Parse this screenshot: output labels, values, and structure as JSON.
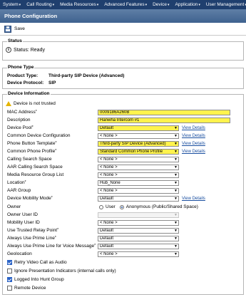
{
  "menubar": {
    "items": [
      "System",
      "Call Routing",
      "Media Resources",
      "Advanced Features",
      "Device",
      "Application",
      "User Management"
    ]
  },
  "page_title": "Phone Configuration",
  "toolbar": {
    "save_label": "Save"
  },
  "status": {
    "legend": "Status",
    "text": "Status: Ready"
  },
  "phone_type": {
    "legend": "Phone Type",
    "product_type_label": "Product Type:",
    "product_type_value": "Third-party SIP Device (Advanced)",
    "protocol_label": "Device Protocol:",
    "protocol_value": "SIP"
  },
  "device_info": {
    "legend": "Device Information",
    "warning": "Device is not trusted",
    "view_details": "View Details",
    "fields": {
      "mac_address": {
        "label": "MAC Address",
        "value": "0009186A260B"
      },
      "description": {
        "label": "Description",
        "value": "Hanwha Intercom #1"
      },
      "device_pool": {
        "label": "Device Pool",
        "value": "Default"
      },
      "common_device_config": {
        "label": "Common Device Configuration",
        "value": "< None >"
      },
      "phone_button_template": {
        "label": "Phone Button Template",
        "value": "Third-party SIP Device (Advanced)"
      },
      "common_phone_profile": {
        "label": "Common Phone Profile",
        "value": "Standard Common Phone Profile"
      },
      "calling_search_space": {
        "label": "Calling Search Space",
        "value": "< None >"
      },
      "aar_css": {
        "label": "AAR Calling Search Space",
        "value": "< None >"
      },
      "mrgl": {
        "label": "Media Resource Group List",
        "value": "< None >"
      },
      "location": {
        "label": "Location",
        "value": "Hub_None"
      },
      "aar_group": {
        "label": "AAR Group",
        "value": "< None >"
      },
      "device_mobility_mode": {
        "label": "Device Mobility Mode",
        "value": "Default"
      },
      "owner": {
        "label": "Owner",
        "opt_user": "User",
        "opt_anon": "Anonymous (Public/Shared Space)"
      },
      "owner_user_id": {
        "label": "Owner User ID",
        "value": ""
      },
      "mobility_user_id": {
        "label": "Mobility User ID",
        "value": "< None >"
      },
      "use_trusted_relay": {
        "label": "Use Trusted Relay Point",
        "value": "Default"
      },
      "always_use_prime_line": {
        "label": "Always Use Prime Line",
        "value": "Default"
      },
      "always_use_prime_line_vm": {
        "label": "Always Use Prime Line for Voice Message",
        "value": "Default"
      },
      "geolocation": {
        "label": "Geolocation",
        "value": "< None >"
      }
    },
    "checkboxes": {
      "retry_video": "Retry Video Call as Audio",
      "ignore_presentation": "Ignore Presentation Indicators (internal calls only)",
      "logged_into_hunt": "Logged Into Hunt Group",
      "remote_device": "Remote Device"
    }
  },
  "colors": {
    "menubar": "#1f3f6e",
    "title_bar": "#4f719b",
    "highlight": "#fff34d",
    "link": "#1a4fa0"
  }
}
